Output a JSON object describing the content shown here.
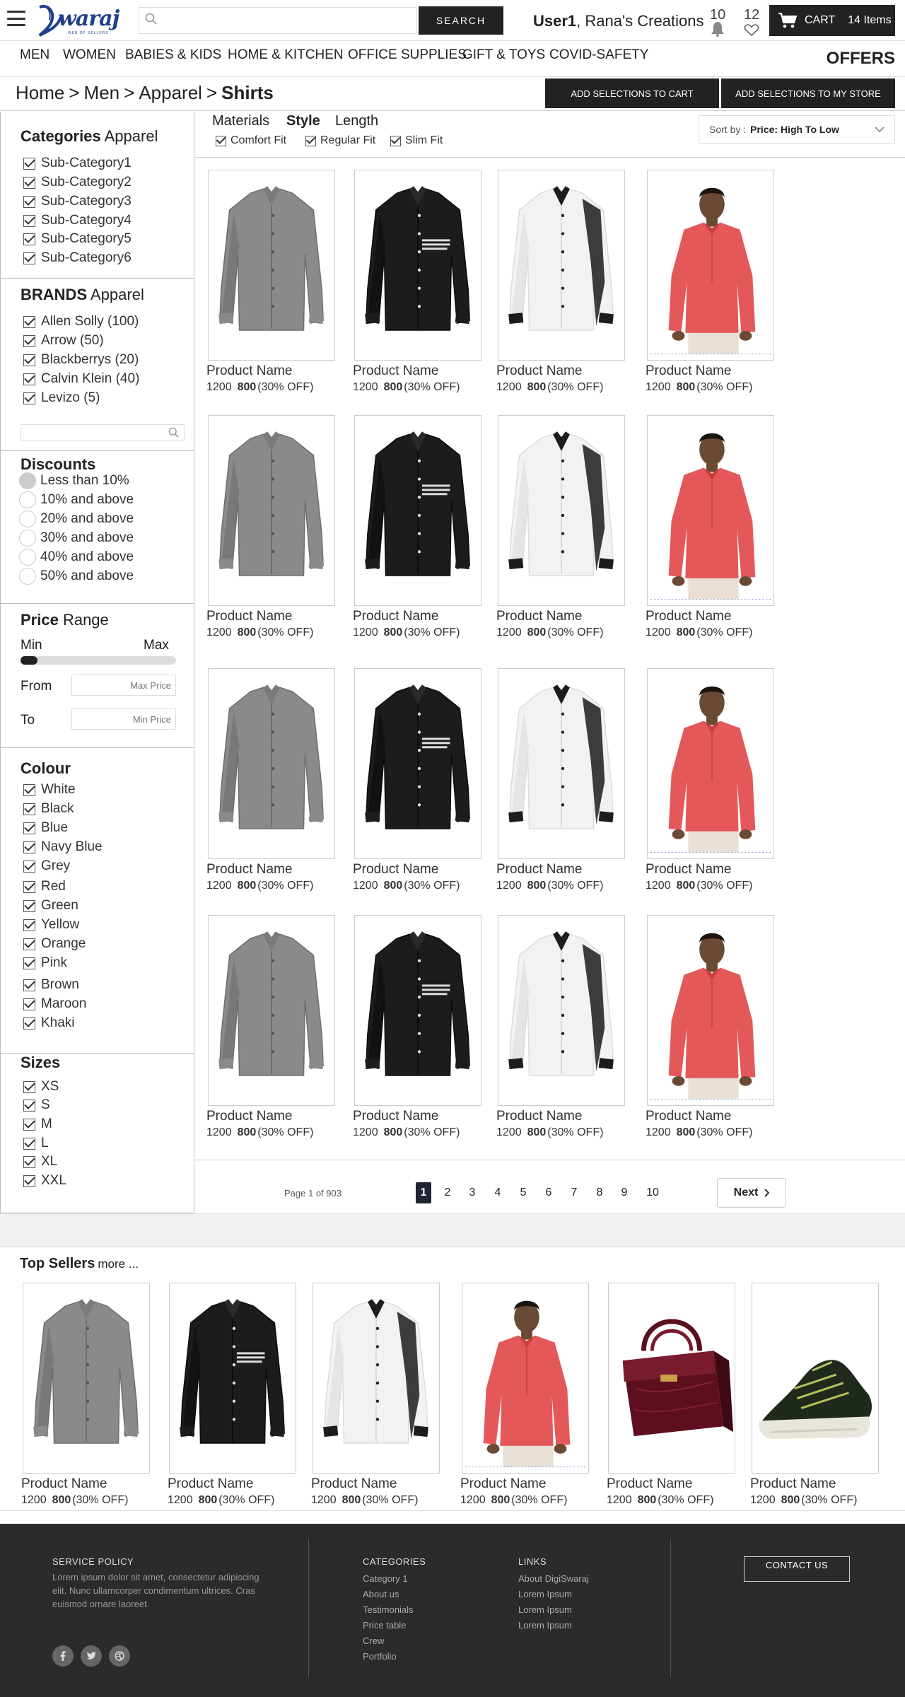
{
  "header": {
    "logo_text": "waraj",
    "logo_sub": "WEB OF SELLERS",
    "search_placeholder": "",
    "search_button": "SEARCH",
    "user_name": "User1",
    "store_name": ", Rana's Creations",
    "notification_count": "10",
    "wishlist_count": "12",
    "cart_label": "CART",
    "cart_items": "14 Items"
  },
  "nav": {
    "items": [
      "MEN",
      "WOMEN",
      "BABIES & KIDS",
      "HOME & KITCHEN",
      "OFFICE SUPPLIES",
      "GIFT & TOYS",
      "COVID-SAFETY"
    ],
    "offers": "OFFERS"
  },
  "breadcrumb": {
    "items": [
      "Home",
      "Men",
      "Apparel"
    ],
    "separator": ">",
    "current": "Shirts"
  },
  "actions": {
    "add_to_cart": "ADD SELECTIONS TO CART",
    "add_to_store": "ADD SELECTIONS TO MY STORE"
  },
  "sidebar": {
    "categories": {
      "title_bold": "Categories",
      "title_rest": " Apparel",
      "items": [
        "Sub-Category1",
        "Sub-Category2",
        "Sub-Category3",
        "Sub-Category4",
        "Sub-Category5",
        "Sub-Category6"
      ]
    },
    "brands": {
      "title_bold": "BRANDS",
      "title_rest": " Apparel",
      "items": [
        "Allen Solly (100)",
        "Arrow (50)",
        "Blackberrys (20)",
        "Calvin Klein (40)",
        "Levizo (5)"
      ]
    },
    "discounts": {
      "title": "Discounts",
      "items": [
        "Less than 10%",
        "10% and above",
        "20% and above",
        "30% and above",
        "40% and above",
        "50% and above"
      ],
      "selected_index": 0
    },
    "price": {
      "title_bold": "Price",
      "title_rest": " Range",
      "min_label": "Min",
      "max_label": "Max",
      "from_label": "From",
      "to_label": "To",
      "from_placeholder": "Max Price",
      "to_placeholder": "Min Price",
      "slider_fraction": 0.1
    },
    "colour": {
      "title": "Colour",
      "items": [
        "White",
        "Black",
        "Blue",
        "Navy Blue",
        "Grey",
        "Red",
        "Green",
        "Yellow",
        "Orange",
        "Pink",
        "Brown",
        "Maroon",
        "Khaki"
      ]
    },
    "sizes": {
      "title": "Sizes",
      "items": [
        "XS",
        "S",
        "M",
        "L",
        "XL",
        "XXL"
      ]
    }
  },
  "filters": {
    "tabs": [
      "Materials",
      "Style",
      "Length"
    ],
    "active_tab": "Style",
    "fits": [
      "Comfort Fit",
      "Regular Fit",
      "Slim Fit"
    ],
    "sort_label": "Sort by :",
    "sort_value": "Price: High To Low"
  },
  "products": {
    "name": "Product Name",
    "old_price": "1200",
    "new_price": "800",
    "discount": "(30% OFF)",
    "variants": [
      "grey-shirt",
      "black-shirt",
      "white-shirt",
      "red-shirt"
    ]
  },
  "pagination": {
    "info": "Page 1 of 903",
    "pages": [
      "1",
      "2",
      "3",
      "4",
      "5",
      "6",
      "7",
      "8",
      "9",
      "10"
    ],
    "active": "1",
    "next": "Next"
  },
  "top_sellers": {
    "title": "Top Sellers",
    "more": "more ...",
    "items": [
      {
        "img": "grey-shirt",
        "name": "Product Name",
        "old_price": "1200",
        "new_price": "800",
        "discount": "(30% OFF)"
      },
      {
        "img": "black-shirt",
        "name": "Product Name",
        "old_price": "1200",
        "new_price": "800",
        "discount": "(30% OFF)"
      },
      {
        "img": "white-shirt",
        "name": "Product Name",
        "old_price": "1200",
        "new_price": "800",
        "discount": "(30% OFF)"
      },
      {
        "img": "red-shirt",
        "name": "Product Name",
        "old_price": "1200",
        "new_price": "800",
        "discount": "(30% OFF)"
      },
      {
        "img": "maroon-handbag",
        "name": "Product Name",
        "old_price": "1200",
        "new_price": "800",
        "discount": "(30% OFF)"
      },
      {
        "img": "sneaker",
        "name": "Product Name",
        "old_price": "1200",
        "new_price": "800",
        "discount": "(30% OFF)"
      }
    ]
  },
  "footer": {
    "service_policy_title": "SERVICE POLICY",
    "service_policy_text": "Lorem ipsum dolor sit amet, consectetur adipiscing elit. Nunc ullamcorper condimentum ultrices. Cras euismod ornare laoreet.",
    "categories_title": "CATEGORIES",
    "categories": [
      "Category 1",
      "About us",
      "Testimonials",
      "Price table",
      "Crew",
      "Portfolio"
    ],
    "links_title": "LINKS",
    "links": [
      "About DigiSwaraj",
      "Lorem Ipsum",
      "Lorem Ipsum",
      "Lorem Ipsum"
    ],
    "contact": "CONTACT US",
    "social": [
      "facebook-icon",
      "twitter-icon",
      "dribbble-icon"
    ]
  },
  "colors": {
    "dark": "#222222",
    "logo_blue": "#1f3f8c",
    "footer_bg": "#2b2b2b",
    "page_active": "#1e2530"
  }
}
